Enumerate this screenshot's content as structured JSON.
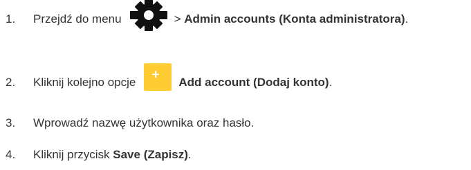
{
  "steps": [
    {
      "number": "1.",
      "before": "Przejdź do menu",
      "icon": "gear-icon",
      "between": ">",
      "bold": "Admin accounts (Konta administratora)",
      "after": "."
    },
    {
      "number": "2.",
      "before": "Kliknij kolejno opcje",
      "icon": "plus-icon",
      "bold": "Add account (Dodaj konto)",
      "after": "."
    },
    {
      "number": "3.",
      "text": "Wprowadź nazwę użytkownika oraz hasło."
    },
    {
      "number": "4.",
      "before": "Kliknij przycisk",
      "bold": "Save (Zapisz)",
      "after": "."
    }
  ],
  "colors": {
    "text": "#333333",
    "gear": "#111111",
    "plus_bg": "#ffcc33",
    "plus_fg": "#ffffff"
  }
}
